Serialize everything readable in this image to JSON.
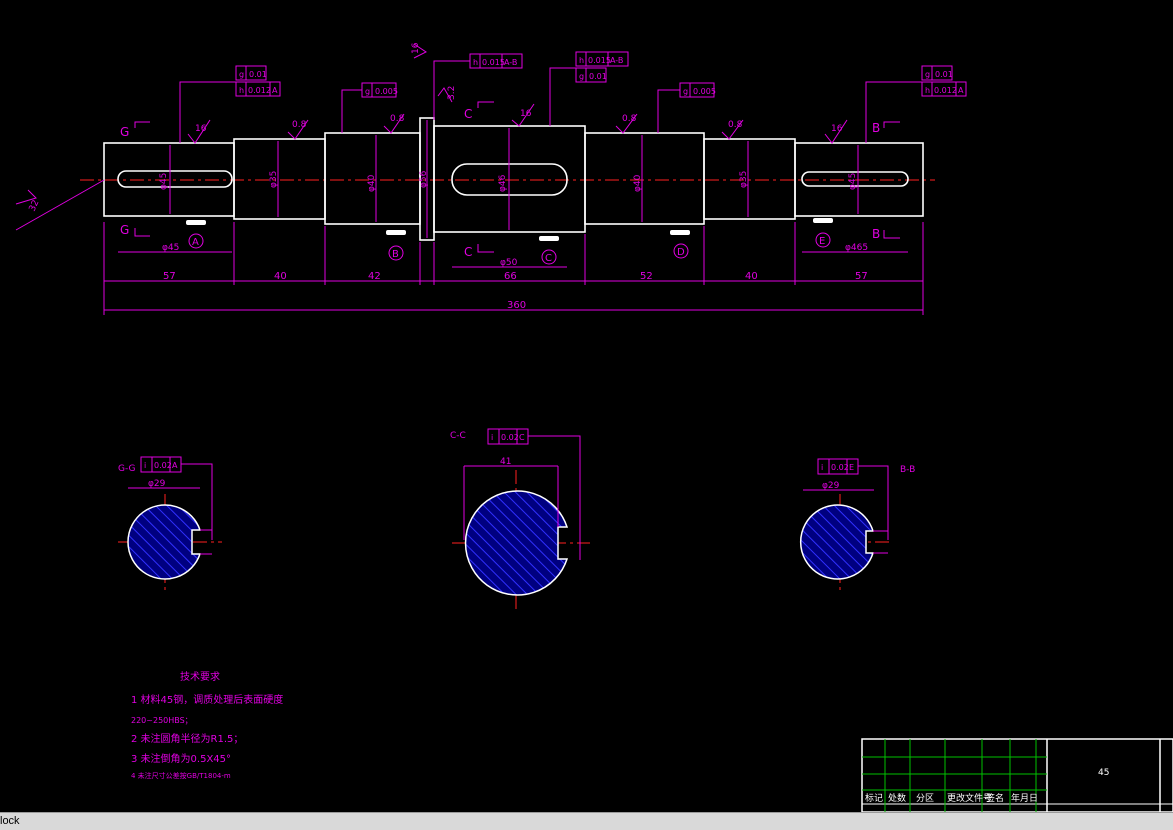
{
  "drawing": {
    "dims": [
      "57",
      "40",
      "42",
      "66",
      "52",
      "40",
      "57"
    ],
    "total_length": "360",
    "datums": [
      "A",
      "B",
      "C",
      "D",
      "E"
    ],
    "diameters": {
      "d1": "φ45",
      "d2": "φ35",
      "d3": "φ40",
      "d4": "φ56",
      "d5": "φ46",
      "d6": "φ40",
      "d7": "φ35",
      "d8": "φ45"
    },
    "bottom_dia": {
      "left": "φ45",
      "mid": "φ50",
      "right": "φ465"
    },
    "roughness": [
      "16",
      "0.8",
      "0.8",
      "16",
      "0.8",
      "0.8",
      "16",
      "16",
      "3.2",
      "32"
    ],
    "section_labels": {
      "left": "G",
      "mid": "C",
      "right": "B"
    },
    "tolerance_frames": {
      "f1": [
        "g",
        "0.01"
      ],
      "f2": [
        "h",
        "0.012",
        "A"
      ],
      "f3": [
        "g",
        "0.005"
      ],
      "f4": [
        "h",
        "0.015",
        "A-B"
      ],
      "f5": [
        "h",
        "0.015",
        "A-B"
      ],
      "f6": [
        "g",
        "0.01"
      ],
      "f7": [
        "g",
        "0.005"
      ],
      "f8": [
        "g",
        "0.01"
      ],
      "f9": [
        "h",
        "0.012",
        "A"
      ]
    },
    "sections": {
      "gg": {
        "label": "G-G",
        "frame": [
          "i",
          "0.02",
          "A"
        ],
        "dia": "φ29"
      },
      "cc": {
        "label": "C-C",
        "frame": [
          "i",
          "0.02",
          "C"
        ],
        "width": "41"
      },
      "bb": {
        "label": "B-B",
        "frame": [
          "i",
          "0.02",
          "E"
        ],
        "dia": "φ29"
      }
    }
  },
  "notes": {
    "title": "技术要求",
    "line1": "1  材料45钢，调质处理后表面硬度",
    "line1b": "220~250HBS；",
    "line2": "2  未注圆角半径为R1.5；",
    "line3": "3  未注倒角为0.5X45°",
    "line4": "4  未注尺寸公差按GB/T1804-m"
  },
  "title_block": {
    "material": "45",
    "headers": [
      "标记",
      "处数",
      "分区",
      "更改文件号",
      "签名",
      "年月日"
    ]
  },
  "status": {
    "command": "lock"
  }
}
